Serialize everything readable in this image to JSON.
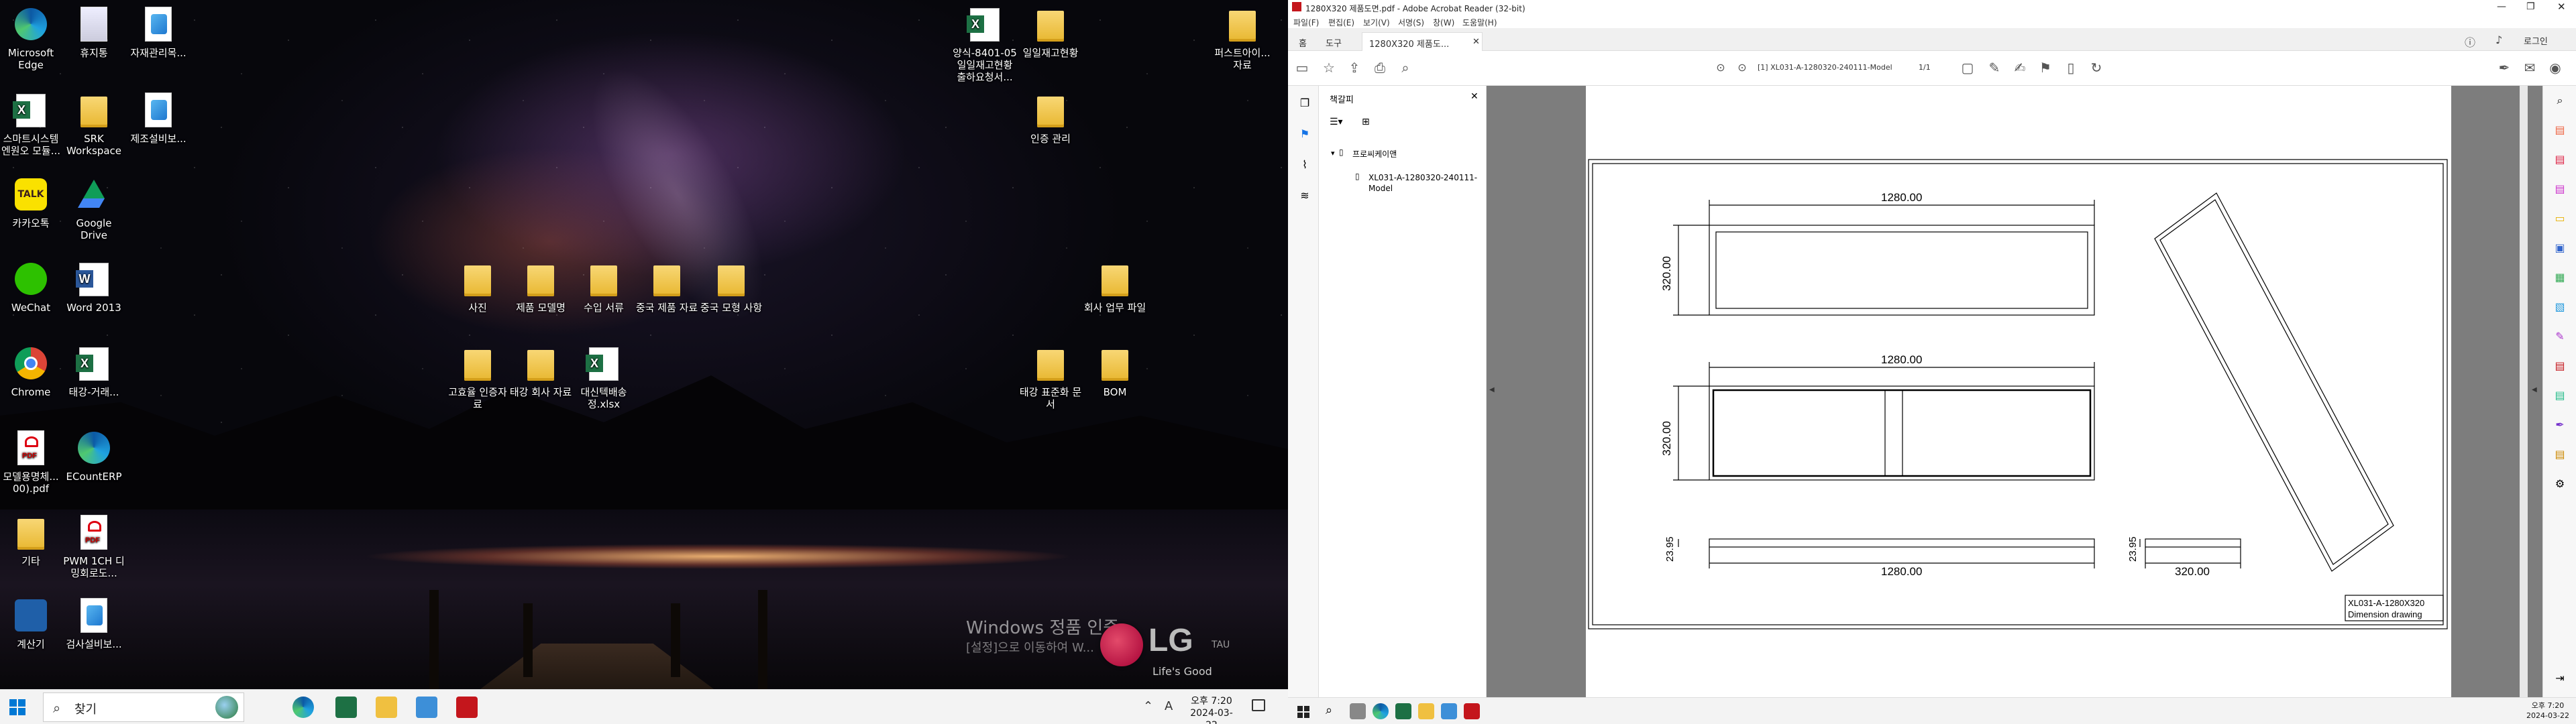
{
  "desktop": {
    "icons": [
      {
        "label": "Microsoft Edge",
        "icon": "edge-icon"
      },
      {
        "label": "휴지통",
        "icon": "recycle-bin-icon"
      },
      {
        "label": "자재관리목...",
        "icon": "doc-icon"
      },
      {
        "label": "스마트시스템 엔원오 모듈...",
        "icon": "excel-icon"
      },
      {
        "label": "SRK Workspace",
        "icon": "folder-icon"
      },
      {
        "label": "제조설비보...",
        "icon": "doc-icon"
      },
      {
        "label": "카카오톡",
        "icon": "kakaotalk-icon"
      },
      {
        "label": "Google Drive",
        "icon": "google-drive-icon"
      },
      {
        "label": "WeChat",
        "icon": "wechat-icon"
      },
      {
        "label": "Word 2013",
        "icon": "word-icon"
      },
      {
        "label": "Chrome",
        "icon": "chrome-icon"
      },
      {
        "label": "태강-거래...",
        "icon": "excel-icon"
      },
      {
        "label": "모델용명체... 00).pdf",
        "icon": "pdf-icon"
      },
      {
        "label": "ECountERP",
        "icon": "edge-icon"
      },
      {
        "label": "기타",
        "icon": "folder-icon"
      },
      {
        "label": "PWM 1CH 디밍회로도...",
        "icon": "pdf-icon"
      },
      {
        "label": "계산기",
        "icon": "calculator-icon"
      },
      {
        "label": "검사설비보...",
        "icon": "doc-icon"
      },
      {
        "label": "사진",
        "icon": "folder-icon"
      },
      {
        "label": "제품 모델명",
        "icon": "folder-icon"
      },
      {
        "label": "수입 서류",
        "icon": "folder-icon"
      },
      {
        "label": "중국 제품 자료",
        "icon": "folder-icon"
      },
      {
        "label": "중국 모형 사항",
        "icon": "folder-icon"
      },
      {
        "label": "고효율 인증자료",
        "icon": "folder-icon"
      },
      {
        "label": "태강 회사 자료",
        "icon": "folder-icon"
      },
      {
        "label": "대신텍배송정.xlsx",
        "icon": "excel-icon"
      },
      {
        "label": "양식-8401-05 일일재고현황 출하요청서...",
        "icon": "excel-icon"
      },
      {
        "label": "일일재고현황",
        "icon": "folder-icon"
      },
      {
        "label": "인증 관리",
        "icon": "folder-icon"
      },
      {
        "label": "퍼스트아이... 자료",
        "icon": "folder-icon"
      },
      {
        "label": "회사 업무 파일",
        "icon": "folder-icon"
      },
      {
        "label": "태강 표준화 문서",
        "icon": "folder-icon"
      },
      {
        "label": "BOM",
        "icon": "folder-icon"
      }
    ],
    "watermark_line1": "Windows 정품 인증",
    "watermark_line2": "[설정]으로 이동하여 W...",
    "lg_brand": "LG",
    "lg_tagline": "Life's Good",
    "lg_sub": "TAU"
  },
  "taskbar_left": {
    "search_placeholder": "찾기",
    "clock_time": "오후 7:20",
    "clock_date": "2024-03-22",
    "ime": "A"
  },
  "acrobat": {
    "title": "1280X320 제품도면.pdf - Adobe Acrobat Reader (32-bit)",
    "menu": [
      "파일(F)",
      "편집(E)",
      "보기(V)",
      "서명(S)",
      "창(W)",
      "도움말(H)"
    ],
    "tabs": {
      "home": "홈",
      "tools": "도구",
      "doc": "1280X320 제품도...",
      "login": "로그인"
    },
    "page_label": "[1] XL031-A-1280320-240111-Model",
    "page_count": "1/1",
    "bookmarks_title": "책갈피",
    "tree_root": "프로씨케이앤",
    "tree_child": "XL031-A-1280320-240111-Model",
    "drawing": {
      "dim_top_width": "1280.00",
      "dim_top_height": "320.00",
      "dim_mid_width": "1280.00",
      "dim_mid_height": "320.00",
      "dim_bottom_width": "1280.00",
      "dim_bottom_depth": "23.95",
      "dim_side_depth": "23.95",
      "dim_side_width": "320.00",
      "titleblock_line1": "XL031-A-1280X320",
      "titleblock_line2": "Dimension drawing"
    }
  },
  "taskbar_right": {
    "clock_time": "오후 7:20",
    "clock_date": "2024-03-22"
  }
}
